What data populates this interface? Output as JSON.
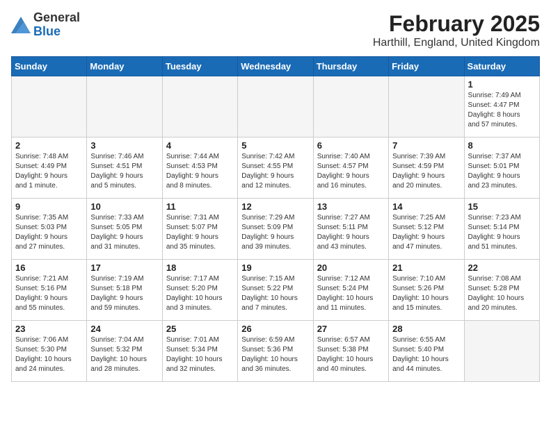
{
  "logo": {
    "general": "General",
    "blue": "Blue"
  },
  "title": "February 2025",
  "subtitle": "Harthill, England, United Kingdom",
  "days_of_week": [
    "Sunday",
    "Monday",
    "Tuesday",
    "Wednesday",
    "Thursday",
    "Friday",
    "Saturday"
  ],
  "weeks": [
    [
      {
        "day": "",
        "info": "",
        "empty": true
      },
      {
        "day": "",
        "info": "",
        "empty": true
      },
      {
        "day": "",
        "info": "",
        "empty": true
      },
      {
        "day": "",
        "info": "",
        "empty": true
      },
      {
        "day": "",
        "info": "",
        "empty": true
      },
      {
        "day": "",
        "info": "",
        "empty": true
      },
      {
        "day": "1",
        "info": "Sunrise: 7:49 AM\nSunset: 4:47 PM\nDaylight: 8 hours\nand 57 minutes.",
        "empty": false
      }
    ],
    [
      {
        "day": "2",
        "info": "Sunrise: 7:48 AM\nSunset: 4:49 PM\nDaylight: 9 hours\nand 1 minute.",
        "empty": false
      },
      {
        "day": "3",
        "info": "Sunrise: 7:46 AM\nSunset: 4:51 PM\nDaylight: 9 hours\nand 5 minutes.",
        "empty": false
      },
      {
        "day": "4",
        "info": "Sunrise: 7:44 AM\nSunset: 4:53 PM\nDaylight: 9 hours\nand 8 minutes.",
        "empty": false
      },
      {
        "day": "5",
        "info": "Sunrise: 7:42 AM\nSunset: 4:55 PM\nDaylight: 9 hours\nand 12 minutes.",
        "empty": false
      },
      {
        "day": "6",
        "info": "Sunrise: 7:40 AM\nSunset: 4:57 PM\nDaylight: 9 hours\nand 16 minutes.",
        "empty": false
      },
      {
        "day": "7",
        "info": "Sunrise: 7:39 AM\nSunset: 4:59 PM\nDaylight: 9 hours\nand 20 minutes.",
        "empty": false
      },
      {
        "day": "8",
        "info": "Sunrise: 7:37 AM\nSunset: 5:01 PM\nDaylight: 9 hours\nand 23 minutes.",
        "empty": false
      }
    ],
    [
      {
        "day": "9",
        "info": "Sunrise: 7:35 AM\nSunset: 5:03 PM\nDaylight: 9 hours\nand 27 minutes.",
        "empty": false
      },
      {
        "day": "10",
        "info": "Sunrise: 7:33 AM\nSunset: 5:05 PM\nDaylight: 9 hours\nand 31 minutes.",
        "empty": false
      },
      {
        "day": "11",
        "info": "Sunrise: 7:31 AM\nSunset: 5:07 PM\nDaylight: 9 hours\nand 35 minutes.",
        "empty": false
      },
      {
        "day": "12",
        "info": "Sunrise: 7:29 AM\nSunset: 5:09 PM\nDaylight: 9 hours\nand 39 minutes.",
        "empty": false
      },
      {
        "day": "13",
        "info": "Sunrise: 7:27 AM\nSunset: 5:11 PM\nDaylight: 9 hours\nand 43 minutes.",
        "empty": false
      },
      {
        "day": "14",
        "info": "Sunrise: 7:25 AM\nSunset: 5:12 PM\nDaylight: 9 hours\nand 47 minutes.",
        "empty": false
      },
      {
        "day": "15",
        "info": "Sunrise: 7:23 AM\nSunset: 5:14 PM\nDaylight: 9 hours\nand 51 minutes.",
        "empty": false
      }
    ],
    [
      {
        "day": "16",
        "info": "Sunrise: 7:21 AM\nSunset: 5:16 PM\nDaylight: 9 hours\nand 55 minutes.",
        "empty": false
      },
      {
        "day": "17",
        "info": "Sunrise: 7:19 AM\nSunset: 5:18 PM\nDaylight: 9 hours\nand 59 minutes.",
        "empty": false
      },
      {
        "day": "18",
        "info": "Sunrise: 7:17 AM\nSunset: 5:20 PM\nDaylight: 10 hours\nand 3 minutes.",
        "empty": false
      },
      {
        "day": "19",
        "info": "Sunrise: 7:15 AM\nSunset: 5:22 PM\nDaylight: 10 hours\nand 7 minutes.",
        "empty": false
      },
      {
        "day": "20",
        "info": "Sunrise: 7:12 AM\nSunset: 5:24 PM\nDaylight: 10 hours\nand 11 minutes.",
        "empty": false
      },
      {
        "day": "21",
        "info": "Sunrise: 7:10 AM\nSunset: 5:26 PM\nDaylight: 10 hours\nand 15 minutes.",
        "empty": false
      },
      {
        "day": "22",
        "info": "Sunrise: 7:08 AM\nSunset: 5:28 PM\nDaylight: 10 hours\nand 20 minutes.",
        "empty": false
      }
    ],
    [
      {
        "day": "23",
        "info": "Sunrise: 7:06 AM\nSunset: 5:30 PM\nDaylight: 10 hours\nand 24 minutes.",
        "empty": false
      },
      {
        "day": "24",
        "info": "Sunrise: 7:04 AM\nSunset: 5:32 PM\nDaylight: 10 hours\nand 28 minutes.",
        "empty": false
      },
      {
        "day": "25",
        "info": "Sunrise: 7:01 AM\nSunset: 5:34 PM\nDaylight: 10 hours\nand 32 minutes.",
        "empty": false
      },
      {
        "day": "26",
        "info": "Sunrise: 6:59 AM\nSunset: 5:36 PM\nDaylight: 10 hours\nand 36 minutes.",
        "empty": false
      },
      {
        "day": "27",
        "info": "Sunrise: 6:57 AM\nSunset: 5:38 PM\nDaylight: 10 hours\nand 40 minutes.",
        "empty": false
      },
      {
        "day": "28",
        "info": "Sunrise: 6:55 AM\nSunset: 5:40 PM\nDaylight: 10 hours\nand 44 minutes.",
        "empty": false
      },
      {
        "day": "",
        "info": "",
        "empty": true
      }
    ]
  ]
}
